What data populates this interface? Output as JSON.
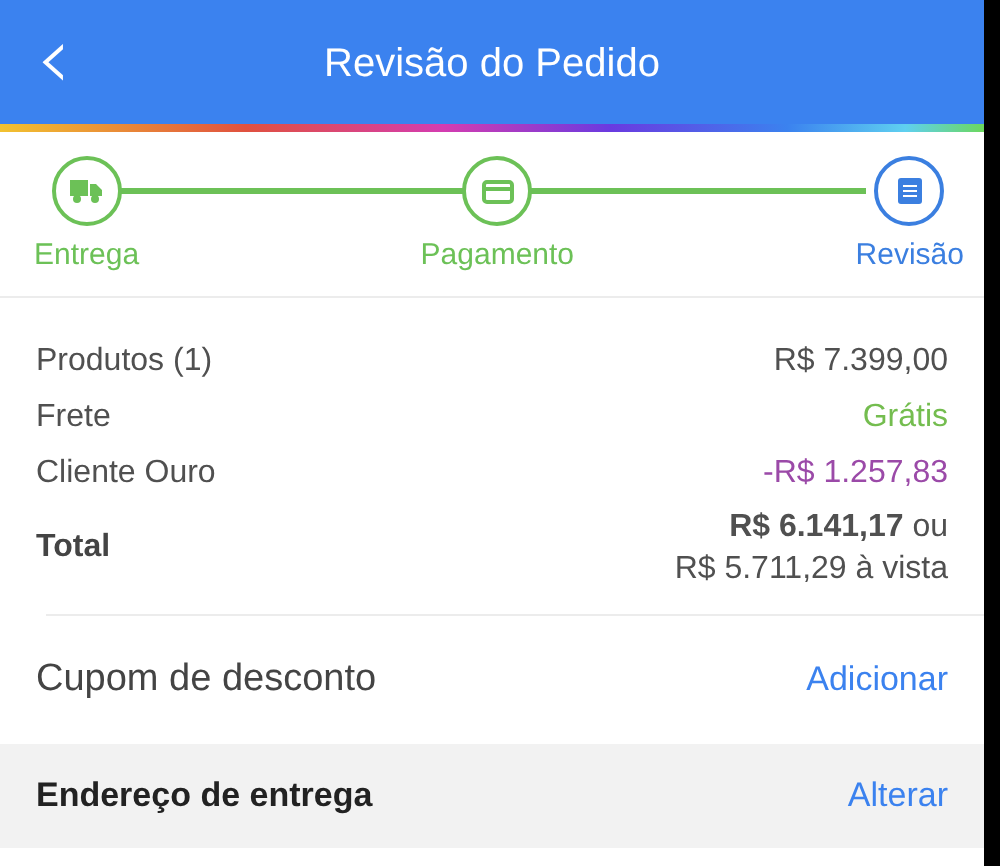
{
  "header": {
    "back": "‹",
    "title": "Revisão do Pedido"
  },
  "steps": [
    {
      "label": "Entrega",
      "current": false
    },
    {
      "label": "Pagamento",
      "current": false
    },
    {
      "label": "Revisão",
      "current": true
    }
  ],
  "summary": [
    {
      "label": "Produtos (1)",
      "value": "R$ 7.399,00",
      "color": "#505050"
    },
    {
      "label": "Frete",
      "value": "Grátis",
      "color": "#74bd4f"
    },
    {
      "label": "Cliente Ouro",
      "value": "-R$ 1.257,83",
      "color": "#9b4aa8"
    }
  ],
  "total": {
    "label": "Total",
    "value": "**R$ 6.141,17** ou",
    "value_2": "R$ 5.711,29 à vista"
  },
  "actions": [
    {
      "label": "Cupom de desconto",
      "action": "Adicionar",
      "kind": "plain"
    },
    {
      "label": "Endereço de entrega",
      "action": "Alterar",
      "kind": "section"
    }
  ]
}
